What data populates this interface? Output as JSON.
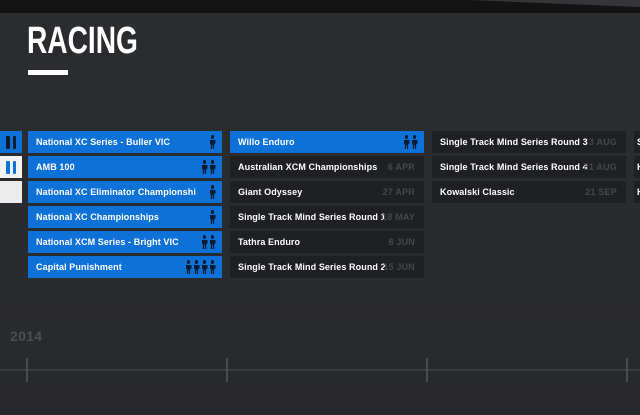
{
  "page": {
    "title": "RACING"
  },
  "timeline": {
    "year": "2014",
    "tick_count": 4
  },
  "colors": {
    "accent_blue": "#0e71d8",
    "item_dark": "#1f2023",
    "item_light": "#f2f2f2",
    "background": "#2a2b2e",
    "top_bar": "#131314",
    "date_text": "#45474b"
  },
  "columns": [
    {
      "id": "past-cutoff",
      "items": [
        {
          "label": "",
          "date": "",
          "style": "blue",
          "persons": 0,
          "icon": "pause"
        },
        {
          "label": "",
          "date": "",
          "style": "light",
          "persons": 0,
          "icon": "pause"
        },
        {
          "label": "",
          "date": "",
          "style": "light",
          "persons": 0,
          "icon": "none"
        }
      ]
    },
    {
      "id": "series-column-1",
      "items": [
        {
          "label": "National XC Series - Buller VIC",
          "date": "",
          "style": "blue",
          "persons": 1,
          "icon": "persons"
        },
        {
          "label": "AMB 100",
          "date": "",
          "style": "blue",
          "persons": 2,
          "icon": "persons"
        },
        {
          "label": "National XC Eliminator Championships",
          "date": "",
          "style": "blue",
          "persons": 1,
          "icon": "persons"
        },
        {
          "label": "National XC Championships",
          "date": "",
          "style": "blue",
          "persons": 1,
          "icon": "persons"
        },
        {
          "label": "National XCM Series - Bright VIC",
          "date": "",
          "style": "blue",
          "persons": 2,
          "icon": "persons"
        },
        {
          "label": "Capital Punishment",
          "date": "",
          "style": "blue",
          "persons": 4,
          "icon": "persons"
        }
      ]
    },
    {
      "id": "series-column-2",
      "items": [
        {
          "label": "Willo Enduro",
          "date": "",
          "style": "blue",
          "persons": 2,
          "icon": "persons"
        },
        {
          "label": "Australian XCM Championships",
          "date": "6 APR",
          "style": "dark",
          "persons": 0,
          "icon": "none"
        },
        {
          "label": "Giant Odyssey",
          "date": "27 APR",
          "style": "dark",
          "persons": 0,
          "icon": "none"
        },
        {
          "label": "Single Track Mind Series Round 1",
          "date": "18 MAY",
          "style": "dark",
          "persons": 0,
          "icon": "none"
        },
        {
          "label": "Tathra Enduro",
          "date": "8 JUN",
          "style": "dark",
          "persons": 0,
          "icon": "none"
        },
        {
          "label": "Single Track Mind Series Round 2",
          "date": "15 JUN",
          "style": "dark",
          "persons": 0,
          "icon": "none"
        }
      ]
    },
    {
      "id": "series-column-3",
      "items": [
        {
          "label": "Single Track Mind Series Round 3",
          "date": "3 AUG",
          "style": "dark",
          "persons": 0,
          "icon": "none"
        },
        {
          "label": "Single Track Mind Series Round 4",
          "date": "31 AUG",
          "style": "dark",
          "persons": 0,
          "icon": "none"
        },
        {
          "label": "Kowalski Classic",
          "date": "21 SEP",
          "style": "dark",
          "persons": 0,
          "icon": "none"
        }
      ]
    },
    {
      "id": "series-column-4-cutoff",
      "items": [
        {
          "label": "S",
          "date": "",
          "style": "dark",
          "persons": 0,
          "icon": "none"
        },
        {
          "label": "H",
          "date": "",
          "style": "dark",
          "persons": 0,
          "icon": "none"
        },
        {
          "label": "H",
          "date": "",
          "style": "dark",
          "persons": 0,
          "icon": "none"
        }
      ]
    }
  ]
}
